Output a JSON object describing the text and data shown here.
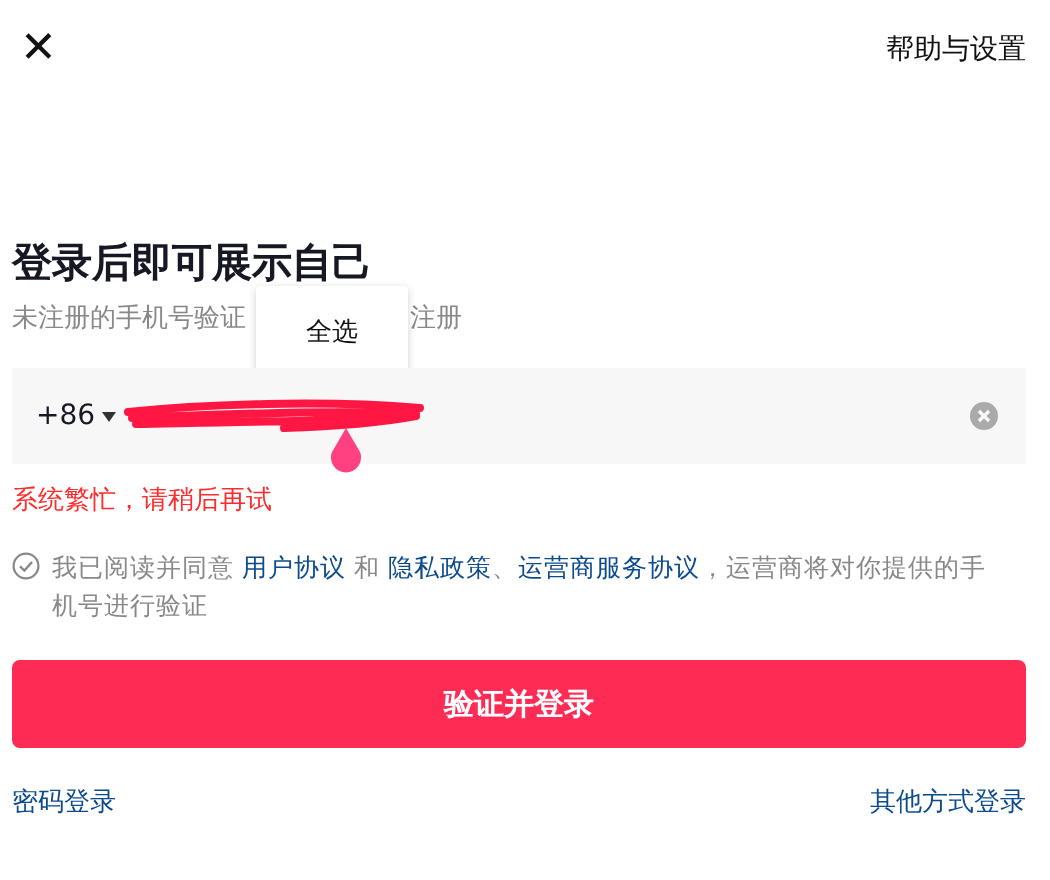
{
  "header": {
    "close": "✕",
    "help": "帮助与设置"
  },
  "title": "登录后即可展示自己",
  "subtitle": {
    "start": "未注册的手机号验证",
    "end": "注册"
  },
  "context_menu": {
    "items": [
      "全选"
    ]
  },
  "phone_field": {
    "country_code": "+86",
    "redacted": true
  },
  "error": "系统繁忙，请稍后再试",
  "agreement": {
    "checked": false,
    "parts": [
      {
        "kind": "text",
        "text": "我已阅读并同意 "
      },
      {
        "kind": "link",
        "text": "用户协议"
      },
      {
        "kind": "text",
        "text": " 和 "
      },
      {
        "kind": "link",
        "text": "隐私政策"
      },
      {
        "kind": "text",
        "text": "、"
      },
      {
        "kind": "link",
        "text": "运营商服务协议"
      },
      {
        "kind": "text",
        "text": "，运营商将对你提供的手机号进行验证"
      }
    ]
  },
  "submit": "验证并登录",
  "footer": {
    "left": "密码登录",
    "right": "其他方式登录"
  }
}
